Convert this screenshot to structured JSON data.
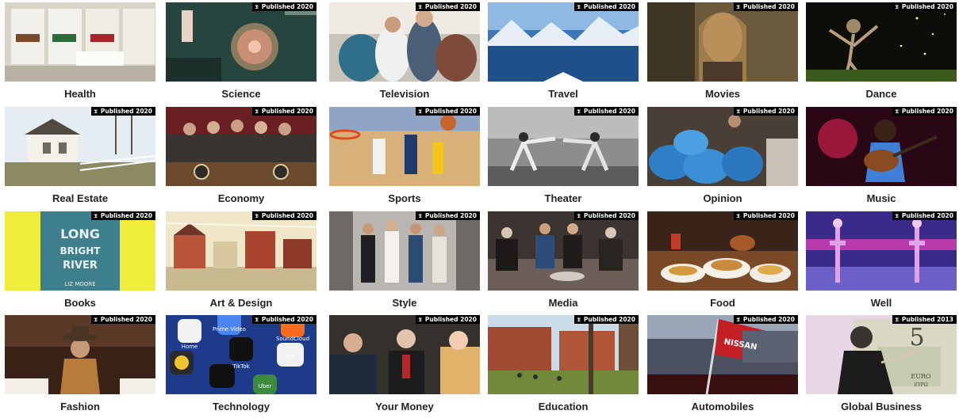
{
  "badge_logo": "𝕿",
  "sections": [
    {
      "label": "Health",
      "badge": "",
      "icon": "vape-pods-photo"
    },
    {
      "label": "Science",
      "badge": "Published 2020",
      "icon": "circuit-photo"
    },
    {
      "label": "Television",
      "badge": "Published 2020",
      "icon": "crowd-photo"
    },
    {
      "label": "Travel",
      "badge": "Published 2020",
      "icon": "mountains-photo"
    },
    {
      "label": "Movies",
      "badge": "Published 2020",
      "icon": "actress-photo"
    },
    {
      "label": "Dance",
      "badge": "Published 2020",
      "icon": "dancer-photo"
    },
    {
      "label": "Real Estate",
      "badge": "Published 2020",
      "icon": "farmhouse-photo"
    },
    {
      "label": "Economy",
      "badge": "Published 2020",
      "icon": "signing-photo"
    },
    {
      "label": "Sports",
      "badge": "Published 2020",
      "icon": "basketball-photo"
    },
    {
      "label": "Theater",
      "badge": "Published 2020",
      "icon": "fencing-photo"
    },
    {
      "label": "Opinion",
      "badge": "Published 2020",
      "icon": "bags-photo"
    },
    {
      "label": "Music",
      "badge": "Published 2020",
      "icon": "guitarist-photo"
    },
    {
      "label": "Books",
      "badge": "Published 2020",
      "icon": "book-cover-photo",
      "cover": [
        "LONG",
        "BRIGHT",
        "RIVER",
        "LIZ MOORE"
      ]
    },
    {
      "label": "Art & Design",
      "badge": "Published 2020",
      "icon": "painting-photo"
    },
    {
      "label": "Style",
      "badge": "Published 2020",
      "icon": "street-photo"
    },
    {
      "label": "Media",
      "badge": "Published 2020",
      "icon": "interview-photo"
    },
    {
      "label": "Food",
      "badge": "Published 2020",
      "icon": "food-photo"
    },
    {
      "label": "Well",
      "badge": "Published 2020",
      "icon": "skaters-photo"
    },
    {
      "label": "Fashion",
      "badge": "Published 2020",
      "icon": "cowboy-photo"
    },
    {
      "label": "Technology",
      "badge": "Published 2020",
      "icon": "phone-apps-photo",
      "apps": [
        "Prime Video",
        "SoundCloud",
        "TikTok",
        "abc",
        "Uber",
        "Home"
      ]
    },
    {
      "label": "Your Money",
      "badge": "Published 2020",
      "icon": "investor-photo"
    },
    {
      "label": "Education",
      "badge": "Published 2020",
      "icon": "campus-photo"
    },
    {
      "label": "Automobiles",
      "badge": "Published 2020",
      "icon": "nissan-flag-photo",
      "flag": "NISSAN"
    },
    {
      "label": "Global Business",
      "badge": "Published 2013",
      "icon": "banknote-photo",
      "note": [
        "5",
        "EURO",
        "EYPΩ"
      ]
    }
  ]
}
